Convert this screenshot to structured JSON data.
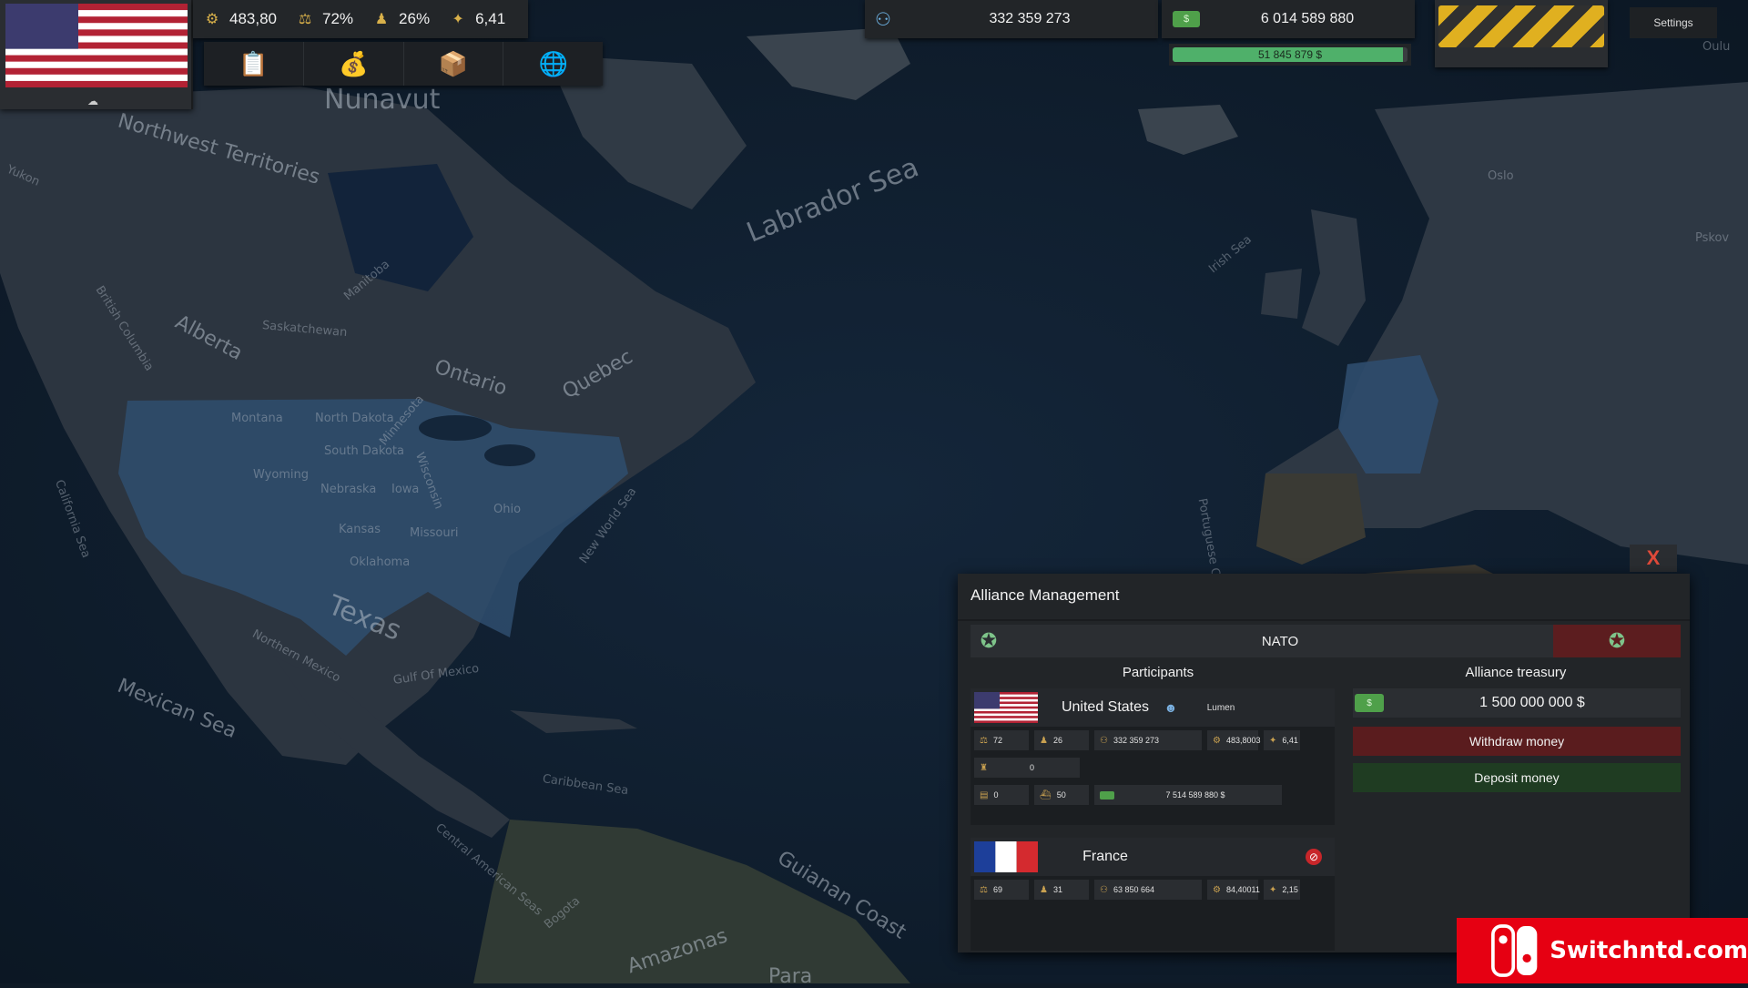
{
  "map": {
    "labels": [
      {
        "text": "Nunavut",
        "cls": "big"
      },
      {
        "text": "Northwest Territories",
        "cls": ""
      },
      {
        "text": "Yukon",
        "cls": ""
      },
      {
        "text": "Labrador Sea",
        "cls": "big"
      },
      {
        "text": "Alberta",
        "cls": ""
      },
      {
        "text": "British Columbia",
        "cls": "small"
      },
      {
        "text": "Manitoba",
        "cls": "small"
      },
      {
        "text": "Saskatchewan",
        "cls": "small"
      },
      {
        "text": "Ontario",
        "cls": ""
      },
      {
        "text": "Quebec",
        "cls": ""
      },
      {
        "text": "Montana",
        "cls": "small"
      },
      {
        "text": "North Dakota",
        "cls": "small"
      },
      {
        "text": "South Dakota",
        "cls": "small"
      },
      {
        "text": "Wyoming",
        "cls": "small"
      },
      {
        "text": "Nebraska",
        "cls": "small"
      },
      {
        "text": "Minnesota",
        "cls": "small"
      },
      {
        "text": "Wisconsin",
        "cls": "small"
      },
      {
        "text": "Iowa",
        "cls": "small"
      },
      {
        "text": "Kansas",
        "cls": "small"
      },
      {
        "text": "Oklahoma",
        "cls": "small"
      },
      {
        "text": "Missouri",
        "cls": "small"
      },
      {
        "text": "Ohio",
        "cls": "small"
      },
      {
        "text": "Texas",
        "cls": "big"
      },
      {
        "text": "California Sea",
        "cls": "small"
      },
      {
        "text": "New World Sea",
        "cls": "small"
      },
      {
        "text": "Northern Mexico",
        "cls": "small"
      },
      {
        "text": "Gulf Of Mexico",
        "cls": "small"
      },
      {
        "text": "Mexican Sea",
        "cls": ""
      },
      {
        "text": "Caribbean Sea",
        "cls": "small"
      },
      {
        "text": "Central American Seas",
        "cls": "small"
      },
      {
        "text": "Guianan Coast",
        "cls": ""
      },
      {
        "text": "Amazonas",
        "cls": ""
      },
      {
        "text": "Bogota",
        "cls": "small"
      },
      {
        "text": "Irish Sea",
        "cls": "small"
      },
      {
        "text": "Portuguese Coast",
        "cls": "small"
      },
      {
        "text": "Oslo",
        "cls": "small"
      },
      {
        "text": "Pskov",
        "cls": "small"
      },
      {
        "text": "Oulu",
        "cls": "small"
      },
      {
        "text": "Para",
        "cls": ""
      }
    ]
  },
  "topbar": {
    "stats": [
      {
        "icon": "gdp-icon",
        "glyph": "⚙",
        "value": "483,80"
      },
      {
        "icon": "stability-icon",
        "glyph": "⚖",
        "value": "72%"
      },
      {
        "icon": "tax-icon",
        "glyph": "♟",
        "value": "26%"
      },
      {
        "icon": "research-icon",
        "glyph": "✦",
        "value": "6,41"
      }
    ],
    "menu": [
      {
        "icon": "laws-icon",
        "glyph": "📋"
      },
      {
        "icon": "economy-icon",
        "glyph": "💰"
      },
      {
        "icon": "trade-icon",
        "glyph": "📦"
      },
      {
        "icon": "diplomacy-icon",
        "glyph": "🌐"
      }
    ],
    "population": "332 359 273",
    "money": "6 014 589 880",
    "progress_text": "51 845 879 $",
    "progress_fraction": 0.98,
    "settings_label": "Settings"
  },
  "alliance": {
    "title": "Alliance Management",
    "name": "NATO",
    "participants_title": "Participants",
    "treasury_title": "Alliance treasury",
    "treasury_value": "1 500 000 000 $",
    "withdraw_label": "Withdraw money",
    "deposit_label": "Deposit money",
    "close_label": "X",
    "participants": [
      {
        "name": "United States",
        "leader": "Lumen",
        "stability": "72",
        "tax": "26",
        "population": "332 359 273",
        "gdp": "483,8003",
        "research": "6,41",
        "army": "0",
        "docs": "0",
        "ships": "50",
        "money": "7 514 589 880 $"
      },
      {
        "name": "France",
        "stability": "69",
        "tax": "31",
        "population": "63 850 664",
        "gdp": "84,40011",
        "research": "2,15"
      }
    ]
  },
  "watermark": {
    "text": "Switchntd.com"
  },
  "colors": {
    "accent_green": "#4fb06a",
    "danger_red": "#5a1c1e",
    "deposit_green": "#1f3c22",
    "close_red": "#e04a3a"
  }
}
